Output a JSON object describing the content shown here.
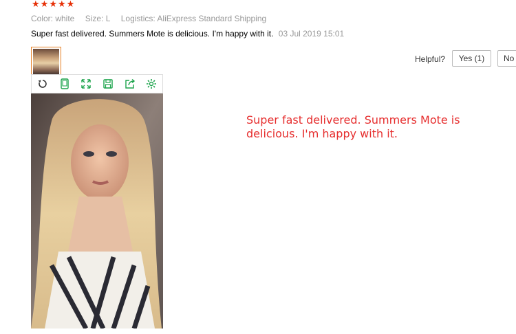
{
  "rating": {
    "stars": 5,
    "star_glyph": "★",
    "star_color": "#e62e04"
  },
  "meta": {
    "color": "Color: white",
    "size": "Size: L",
    "logistics": "Logistics: AliExpress Standard Shipping"
  },
  "review": {
    "text": "Super fast delivered. Summers Mote is delicious. I'm happy with it.",
    "date": "03 Jul 2019 15:01"
  },
  "helpful": {
    "label": "Helpful?",
    "yes_label": "Yes (1)",
    "no_label": "No"
  },
  "toolbar": {
    "icons": [
      "rotate-icon",
      "phone-icon",
      "expand-icon",
      "save-icon",
      "share-icon",
      "settings-icon"
    ]
  },
  "translation": {
    "text": "Super fast delivered. Summers Mote is delicious. I'm happy with it."
  },
  "colors": {
    "accent": "#1aa34a",
    "thumb_border": "#e67e22",
    "translation": "#e62e2e"
  }
}
